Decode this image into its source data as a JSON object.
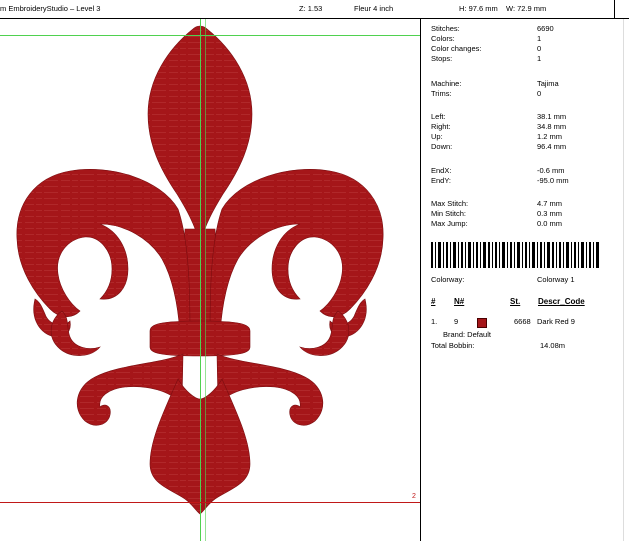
{
  "header": {
    "title": "m EmbroideryStudio – Level 3",
    "zoom": "Z: 1.53",
    "design_name": "Fleur 4 inch",
    "height": "H: 97.6 mm",
    "width": "W: 72.9 mm"
  },
  "canvas": {
    "marker_label": "2",
    "design_color": "#a51619"
  },
  "panel": {
    "stitches_label": "Stitches:",
    "stitches": "6690",
    "colors_label": "Colors:",
    "colors": "1",
    "color_changes_label": "Color changes:",
    "color_changes": "0",
    "stops_label": "Stops:",
    "stops": "1",
    "machine_label": "Machine:",
    "machine": "Tajima",
    "trims_label": "Trims:",
    "trims": "0",
    "left_label": "Left:",
    "left": "38.1 mm",
    "right_label": "Right:",
    "right": "34.8 mm",
    "up_label": "Up:",
    "up": "1.2 mm",
    "down_label": "Down:",
    "down": "96.4 mm",
    "endx_label": "EndX:",
    "endx": "-0.6 mm",
    "endy_label": "EndY:",
    "endy": "-95.0 mm",
    "max_stitch_label": "Max Stitch:",
    "max_stitch": "4.7 mm",
    "min_stitch_label": "Min Stitch:",
    "min_stitch": "0.3 mm",
    "max_jump_label": "Max Jump:",
    "max_jump": "0.0 mm",
    "colorway_label": "Colorway:",
    "colorway": "Colorway 1",
    "table_headers": {
      "num": "#",
      "needle": "N#",
      "st": "St.",
      "descr": "Descr_Code"
    },
    "color_row": {
      "index": "1.",
      "needle": "9",
      "stitches": "6668",
      "descr": "Dark Red 9",
      "swatch_color": "#a51619"
    },
    "brand": "Brand: Default",
    "total_bobbin_label": "Total Bobbin:",
    "total_bobbin": "14.08m"
  }
}
